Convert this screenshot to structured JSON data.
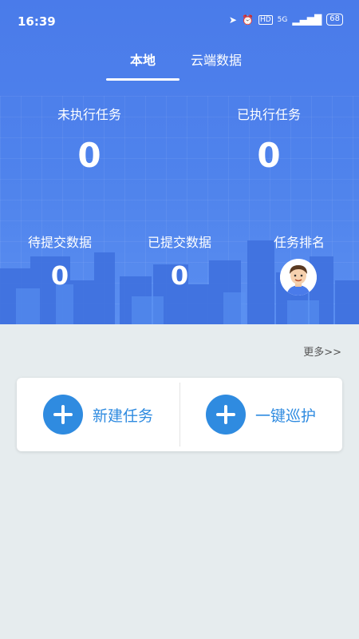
{
  "status": {
    "time": "16:39",
    "network": "5G",
    "battery": "68"
  },
  "tabs": [
    {
      "label": "本地",
      "active": true
    },
    {
      "label": "云端数据",
      "active": false
    }
  ],
  "stats": {
    "unexecuted_label": "未执行任务",
    "unexecuted_value": "0",
    "executed_label": "已执行任务",
    "executed_value": "0",
    "pending_label": "待提交数据",
    "pending_value": "0",
    "submitted_label": "已提交数据",
    "submitted_value": "0",
    "ranking_label": "任务排名"
  },
  "more_link": "更多>>",
  "actions": {
    "new_task": "新建任务",
    "one_click_patrol": "一键巡护"
  },
  "colors": {
    "primary": "#4f83ec",
    "accent": "#2f8be0",
    "background": "#e6ecee"
  }
}
